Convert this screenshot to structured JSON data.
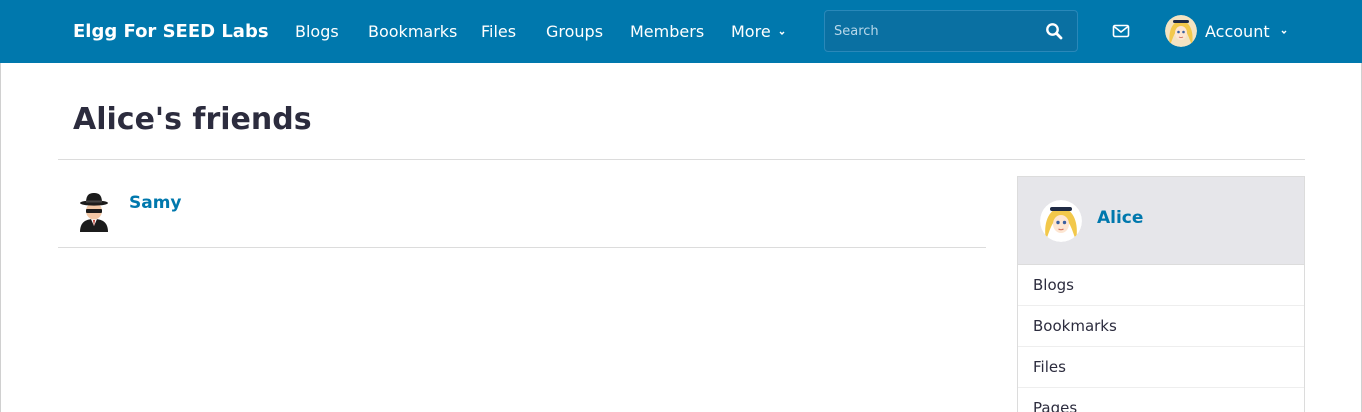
{
  "topbar": {
    "brand": "Elgg For SEED Labs",
    "nav": {
      "blogs": "Blogs",
      "bookmarks": "Bookmarks",
      "files": "Files",
      "groups": "Groups",
      "members": "Members",
      "more": "More"
    },
    "search": {
      "placeholder": "Search"
    },
    "account_label": "Account",
    "icons": {
      "search": "search-icon",
      "mail": "mail-icon",
      "caret": "chevron-down-icon"
    }
  },
  "main": {
    "title": "Alice's friends",
    "friends": [
      {
        "name": "Samy",
        "avatar": "spy-avatar"
      }
    ]
  },
  "sidebar": {
    "owner": {
      "name": "Alice",
      "avatar": "alice-avatar"
    },
    "items": [
      {
        "label": "Blogs"
      },
      {
        "label": "Bookmarks"
      },
      {
        "label": "Files"
      },
      {
        "label": "Pages"
      }
    ]
  },
  "colors": {
    "topbar": "#0078ad",
    "link": "#0078ad",
    "text": "#2c2c3e",
    "sidebar_header": "#e6e6ea"
  }
}
